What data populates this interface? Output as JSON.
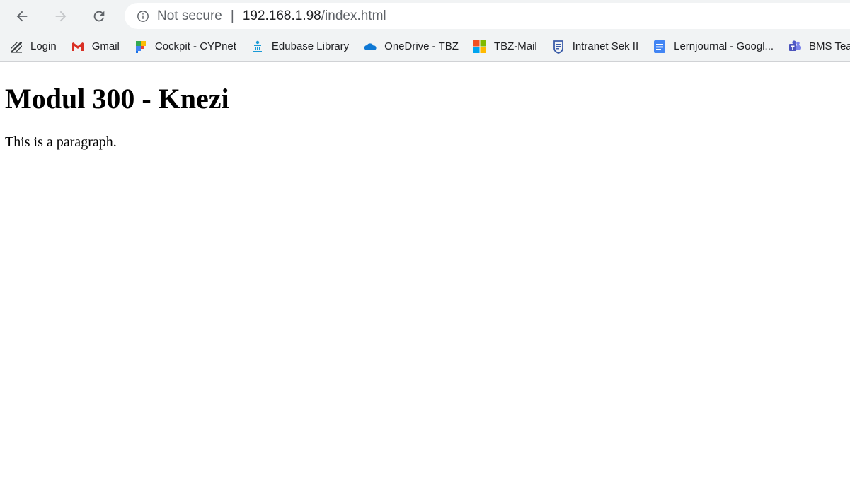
{
  "browser": {
    "address_bar": {
      "security_label": "Not secure",
      "separator": "|",
      "url_host": "192.168.1.98",
      "url_path": "/index.html"
    },
    "bookmarks": [
      {
        "label": "Login",
        "icon": "login-logo-icon"
      },
      {
        "label": "Gmail",
        "icon": "gmail-icon"
      },
      {
        "label": "Cockpit - CYPnet",
        "icon": "cockpit-icon"
      },
      {
        "label": "Edubase Library",
        "icon": "edubase-icon"
      },
      {
        "label": "OneDrive - TBZ",
        "icon": "onedrive-icon"
      },
      {
        "label": "TBZ-Mail",
        "icon": "microsoft-icon"
      },
      {
        "label": "Intranet Sek II",
        "icon": "intranet-icon"
      },
      {
        "label": "Lernjournal - Googl...",
        "icon": "google-docs-icon"
      },
      {
        "label": "BMS Teams",
        "icon": "teams-icon"
      }
    ]
  },
  "page": {
    "heading": "Modul 300 - Knezi",
    "paragraph": "This is a paragraph."
  }
}
